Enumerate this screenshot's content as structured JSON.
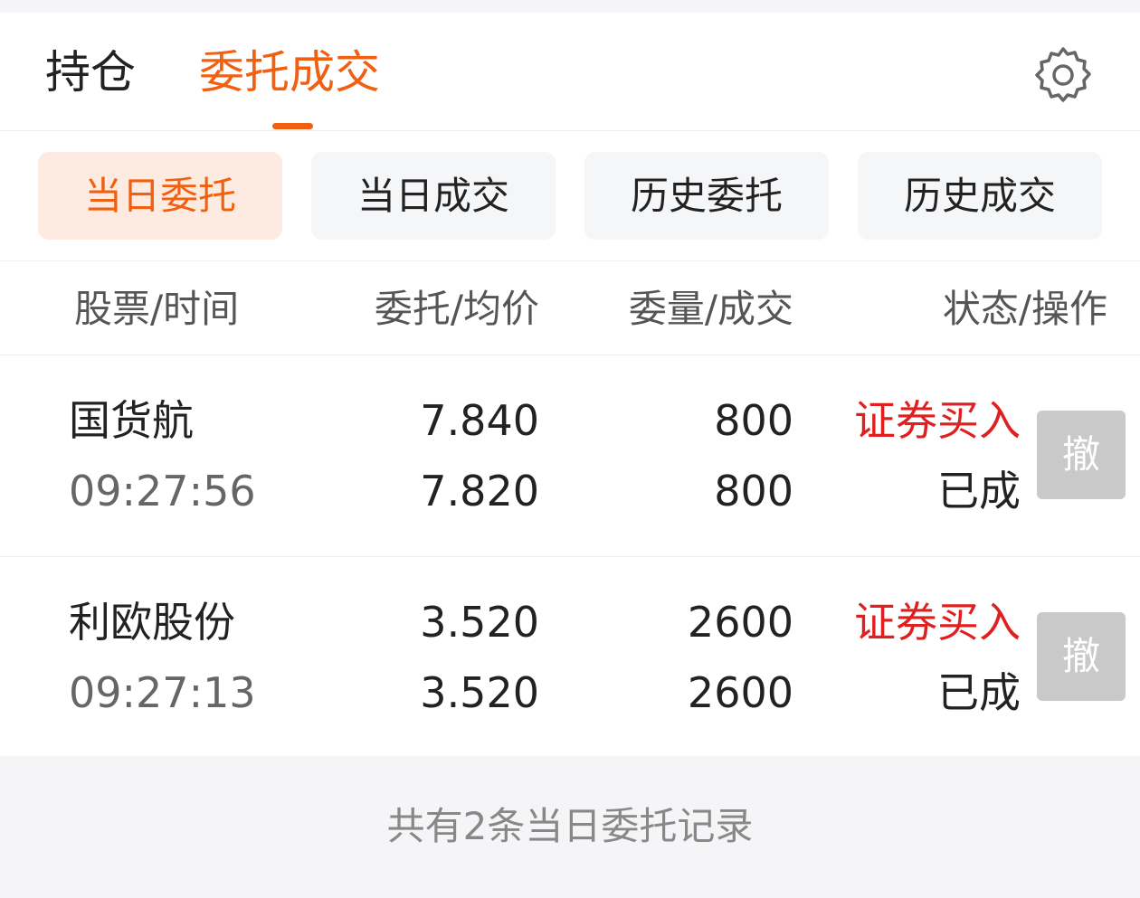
{
  "top_tabs": {
    "holdings": "持仓",
    "orders": "委托成交",
    "active": "orders"
  },
  "sub_tabs": [
    "当日委托",
    "当日成交",
    "历史委托",
    "历史成交"
  ],
  "sub_tab_active": "当日委托",
  "columns": [
    "股票/时间",
    "委托/均价",
    "委量/成交",
    "状态/操作"
  ],
  "orders": [
    {
      "name": "国货航",
      "time": "09:27:56",
      "order_price": "7.840",
      "avg_price": "7.820",
      "order_qty": "800",
      "filled_qty": "800",
      "direction": "证券买入",
      "status": "已成",
      "action": "撤"
    },
    {
      "name": "利欧股份",
      "time": "09:27:13",
      "order_price": "3.520",
      "avg_price": "3.520",
      "order_qty": "2600",
      "filled_qty": "2600",
      "direction": "证券买入",
      "status": "已成",
      "action": "撤"
    }
  ],
  "footer": "共有2条当日委托记录",
  "icons": {
    "settings": "gear-icon"
  },
  "colors": {
    "accent": "#f06010",
    "active_tab_bg": "#fdebe1",
    "buy": "#e02020",
    "disabled_button": "#c9c9c9"
  }
}
